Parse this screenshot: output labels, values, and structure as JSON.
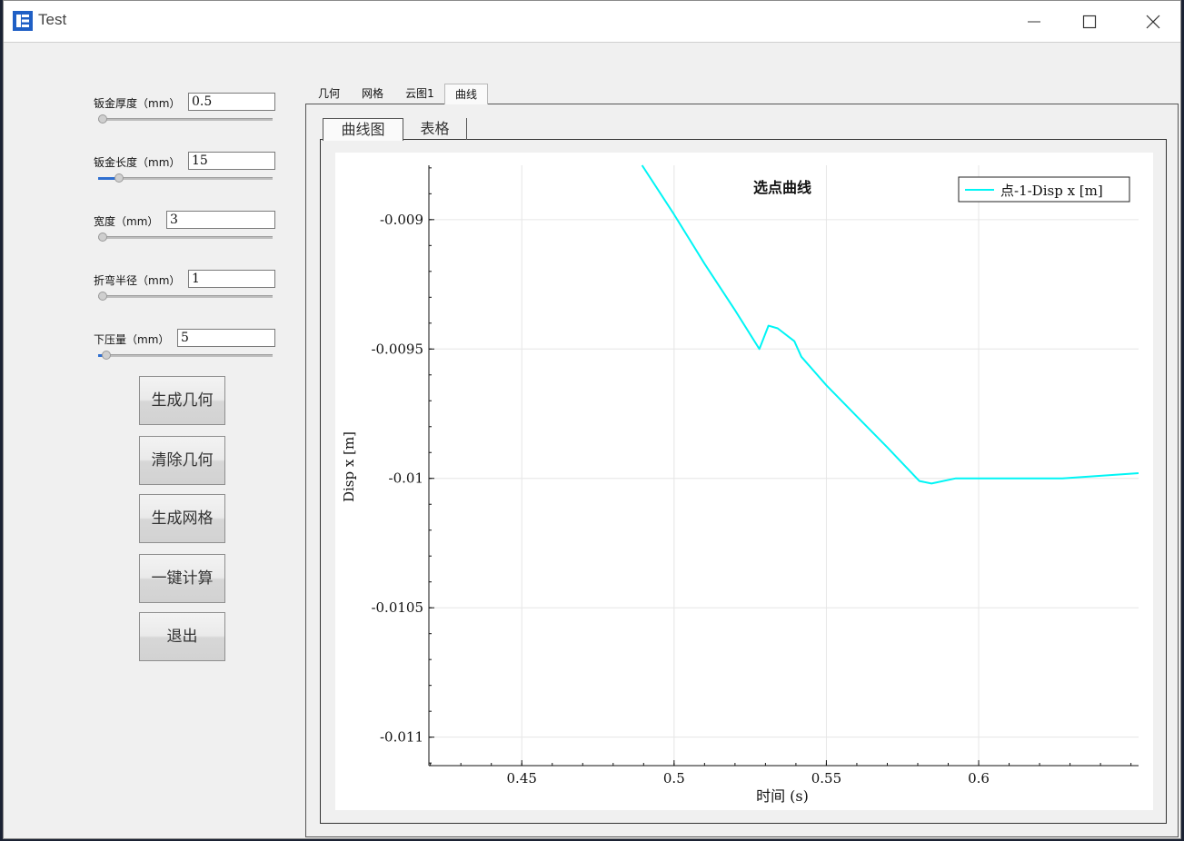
{
  "window": {
    "title": "Test"
  },
  "params": [
    {
      "label": "钣金厚度（mm）",
      "value": "0.5",
      "slider_value": 0.0
    },
    {
      "label": "钣金长度（mm）",
      "value": "15",
      "slider_value": 0.1
    },
    {
      "label": "宽度（mm）",
      "value": "3",
      "slider_value": 0.0
    },
    {
      "label": "折弯半径（mm）",
      "value": "1",
      "slider_value": 0.0
    },
    {
      "label": "下压量（mm）",
      "value": "5",
      "slider_value": 0.02
    }
  ],
  "buttons": {
    "generate_geometry": "生成几何",
    "clear_geometry": "清除几何",
    "generate_mesh": "生成网格",
    "one_click_compute": "一键计算",
    "exit": "退出"
  },
  "tabs": {
    "top": [
      "几何",
      "网格",
      "云图1",
      "曲线"
    ],
    "top_active": "曲线",
    "sub": [
      "曲线图",
      "表格"
    ],
    "sub_active": "曲线图"
  },
  "colors": {
    "accent": "#2f6fd0",
    "series": "#00f5f5"
  },
  "chart_data": {
    "type": "line",
    "title": "选点曲线",
    "xlabel": "时间 (s)",
    "ylabel": "Disp x [m]",
    "xlim": [
      0.4195,
      0.6525
    ],
    "ylim": [
      -0.01111,
      -0.00879
    ],
    "xticks": [
      0.45,
      0.5,
      0.55,
      0.6
    ],
    "xtick_labels": [
      "0.45",
      "0.5",
      "0.55",
      "0.6"
    ],
    "yticks": [
      -0.009,
      -0.0095,
      -0.01,
      -0.0105,
      -0.011
    ],
    "ytick_labels": [
      "-0.009",
      "-0.0095",
      "-0.01",
      "-0.0105",
      "-0.011"
    ],
    "grid": true,
    "legend": "top-right",
    "series": [
      {
        "name": "点-1-Disp x [m]",
        "x": [
          0.4895,
          0.5,
          0.51,
          0.52,
          0.528,
          0.531,
          0.534,
          0.5395,
          0.5418,
          0.55,
          0.56,
          0.57,
          0.5805,
          0.5845,
          0.5925,
          0.61,
          0.6275,
          0.6525
        ],
        "y": [
          -0.00879,
          -0.00898,
          -0.00917,
          -0.00935,
          -0.0095,
          -0.00941,
          -0.00942,
          -0.00947,
          -0.00953,
          -0.00964,
          -0.00976,
          -0.00988,
          -0.01001,
          -0.01002,
          -0.01,
          -0.01,
          -0.01,
          -0.00998
        ]
      }
    ]
  }
}
